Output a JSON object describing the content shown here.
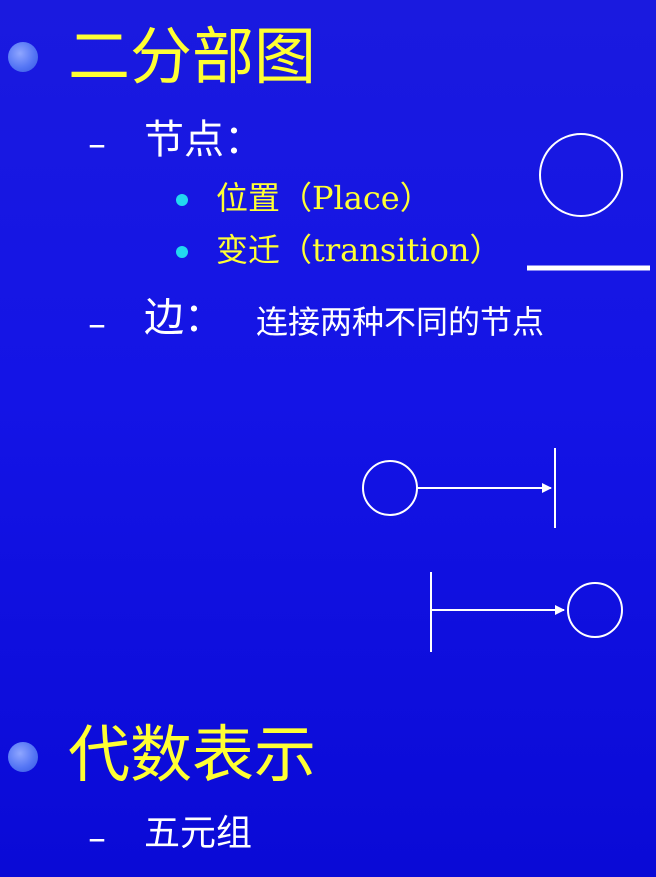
{
  "slide": {
    "section1": {
      "title": "二分部图",
      "nodes_label": "节点：",
      "place_item": "位置（Place）",
      "transition_item": "变迁（transition）",
      "edge_label": "边：",
      "edge_desc": "连接两种不同的节点"
    },
    "section2": {
      "title": "代数表示",
      "sub_item": "五元组"
    },
    "colors": {
      "background": "#1414e6",
      "heading": "#ffff33",
      "text": "#ffffff",
      "small_bullet": "#22d8f0",
      "big_bullet": "#5576f5"
    },
    "icons": {
      "place_symbol": "circle-icon",
      "transition_symbol": "bar-icon",
      "arc_place_to_transition": "arrow-icon",
      "arc_transition_to_place": "arrow-icon"
    }
  }
}
